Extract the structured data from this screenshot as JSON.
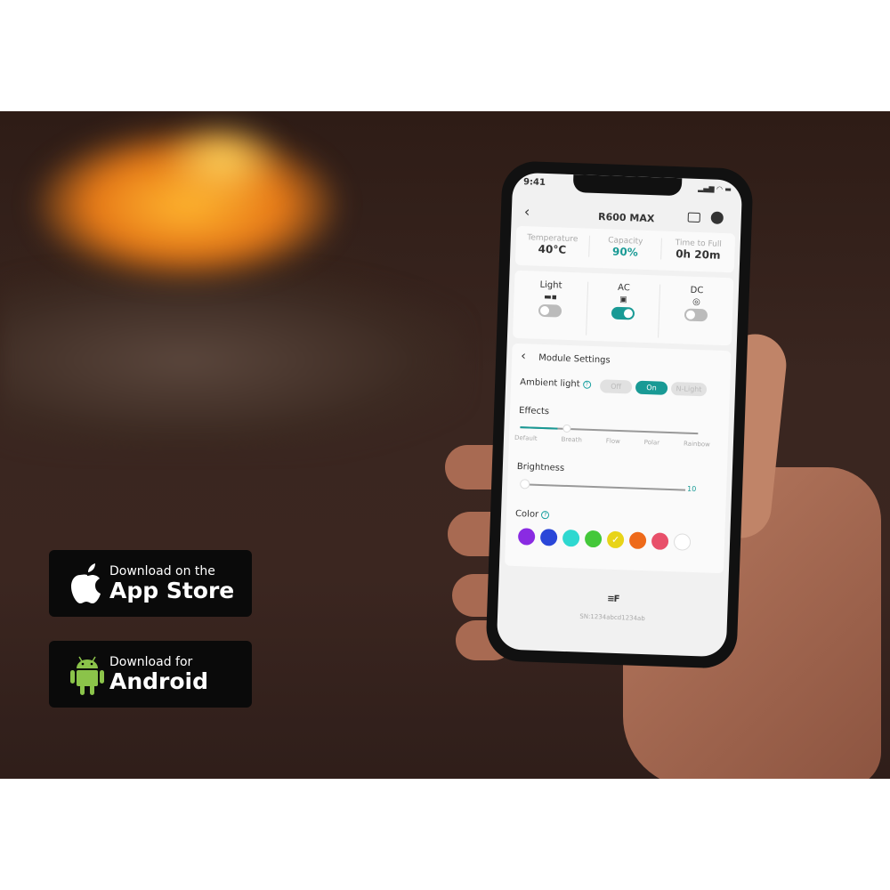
{
  "app": {
    "time": "9:41",
    "title": "R600 MAX",
    "stats": [
      {
        "label": "Temperature",
        "value": "40°C"
      },
      {
        "label": "Capacity",
        "value": "90%"
      },
      {
        "label": "Time to Full",
        "value": "0h 20m"
      }
    ],
    "outputs": [
      {
        "label": "Light",
        "icon": "flashlight-icon",
        "on": false
      },
      {
        "label": "AC",
        "icon": "ac-outlet-icon",
        "on": true
      },
      {
        "label": "DC",
        "icon": "dc-port-icon",
        "on": false
      }
    ],
    "module_title": "Module Settings",
    "ambient_label": "Ambient light",
    "ambient_options": [
      "Off",
      "On",
      "N-Light"
    ],
    "ambient_selected": "On",
    "effects_label": "Effects",
    "effects": [
      "Default",
      "Breath",
      "Flow",
      "Polar",
      "Rainbow"
    ],
    "effects_selected": "Default",
    "brightness_label": "Brightness",
    "brightness_value": "10",
    "color_label": "Color",
    "colors": [
      "#8a2be2",
      "#2a46d8",
      "#2ed8d0",
      "#44c83a",
      "#e8d418",
      "#ee6a1a",
      "#e8506a",
      "#ffffff"
    ],
    "color_selected": "#e8d418",
    "serial": "SN:1234abcd1234ab",
    "accent": "#199a95"
  },
  "badges": {
    "apple_small": "Download on the",
    "apple_big": "App Store",
    "android_small": "Download for",
    "android_big": "Android"
  }
}
